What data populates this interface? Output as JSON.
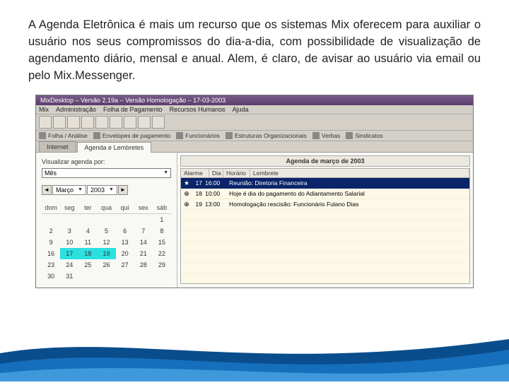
{
  "description": "A Agenda Eletrônica é mais um recurso que os sistemas Mix oferecem para auxiliar o usuário nos seus compromissos do dia-a-dia, com possibilidade de visualização de agendamento diário, mensal e anual. Alem, é claro, de avisar ao usuário via email ou pelo Mix.Messenger.",
  "window": {
    "title": "MixDesktop – Versão 2.19a – Versão Homologação – 17-03-2003"
  },
  "menus": [
    "Mix",
    "Administração",
    "Folha de Pagamento",
    "Recursos Humanos",
    "Ajuda"
  ],
  "tabs": [
    "Folha / Análise",
    "Envelopes de pagamento",
    "Funcionários",
    "Estruturas Organizacionais",
    "Verbas",
    "Sindicatos"
  ],
  "subtabs": {
    "internet": "Internet",
    "agenda": "Agenda e Lembretes"
  },
  "filter": {
    "label": "Visualizar agenda por:",
    "value": "Mês"
  },
  "nav": {
    "month": "Março",
    "year": "2003"
  },
  "calendar": {
    "headers": [
      "dom",
      "seg",
      "ter",
      "qua",
      "qui",
      "sex",
      "sáb"
    ],
    "rows": [
      [
        "",
        "",
        "",
        "",
        "",
        "",
        "1"
      ],
      [
        "2",
        "3",
        "4",
        "5",
        "6",
        "7",
        "8"
      ],
      [
        "9",
        "10",
        "11",
        "12",
        "13",
        "14",
        "15"
      ],
      [
        "16",
        "17",
        "18",
        "19",
        "20",
        "21",
        "22"
      ],
      [
        "23",
        "24",
        "25",
        "26",
        "27",
        "28",
        "29"
      ],
      [
        "30",
        "31",
        "",
        "",
        "",
        "",
        ""
      ]
    ],
    "highlighted": [
      "17",
      "18",
      "19"
    ]
  },
  "agenda": {
    "title": "Agenda de março de 2003",
    "cols": {
      "alarme": "Alarme",
      "dia": "Dia",
      "horario": "Horário",
      "lembrete": "Lembrete"
    },
    "rows": [
      {
        "icon": "★",
        "day": "17",
        "time": "16:00",
        "text": "Reunião: Diretoria Financeira",
        "sel": true
      },
      {
        "icon": "⊕",
        "day": "18",
        "time": "10:00",
        "text": "Hoje é dia do pagamento do Adiantamento Salarial",
        "sel": false
      },
      {
        "icon": "⊕",
        "day": "19",
        "time": "13:00",
        "text": "Homologação rescisão: Funcionário Fulano Dias",
        "sel": false
      }
    ]
  }
}
